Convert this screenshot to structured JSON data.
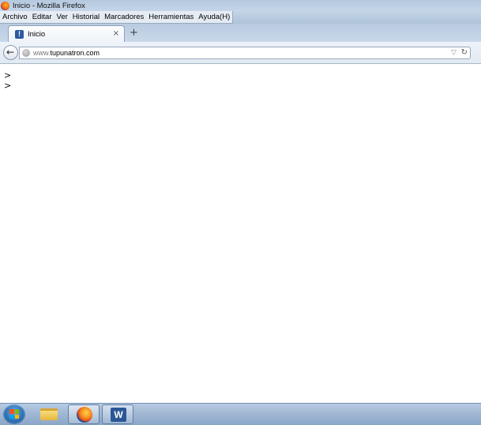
{
  "window": {
    "title": "Inicio - Mozilla Firefox"
  },
  "menu": {
    "items": [
      {
        "label": "Archivo"
      },
      {
        "label": "Editar"
      },
      {
        "label": "Ver"
      },
      {
        "label": "Historial"
      },
      {
        "label": "Marcadores"
      },
      {
        "label": "Herramientas"
      },
      {
        "label": "Ayuda(H)"
      }
    ]
  },
  "tabs": [
    {
      "label": "Inicio",
      "favicon_glyph": "!",
      "close_glyph": "×"
    }
  ],
  "new_tab_glyph": "+",
  "navigation": {
    "back_glyph": "←",
    "url_prefix": "www.",
    "url_domain": "tupunatron.com",
    "dropdown_glyph": "▽",
    "reload_glyph": "↻"
  },
  "content": {
    "lines": [
      ">",
      ">"
    ]
  },
  "taskbar": {
    "icons": [
      "windows-start-icon",
      "explorer-folder-icon",
      "firefox-icon",
      "word-icon"
    ],
    "word_glyph": "W"
  },
  "colors": {
    "titlebar": "#b5c9de",
    "taskbar": "#9fb7d3",
    "url_prefix": "#777777",
    "firefox_orange": "#f58a1f",
    "word_blue": "#2b5797"
  }
}
